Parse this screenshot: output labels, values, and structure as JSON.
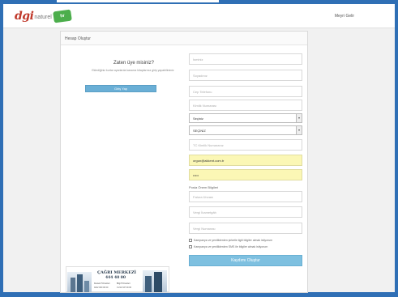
{
  "header": {
    "logo_main": "dgi",
    "logo_sub": "naturel",
    "logo_badge": "tv",
    "user_link": "Meyri Gelir"
  },
  "panel": {
    "title": "Hesap Oluştur"
  },
  "login": {
    "question": "Zaten üye misiniz?",
    "description": "Eklediğiniz kurtar ayarlarıla kasanız kitaplarınız giriş yapabilirsiniz",
    "button_label": "Giriş Yap"
  },
  "form": {
    "name_placeholder": "İsminiz",
    "surname_placeholder": "Soyadınız",
    "phone_placeholder": "Cep Telefonu",
    "tckn_placeholder": "Kimlik Numarası",
    "city_value": "Seçiniz",
    "district_value": "SEÇİNİZ",
    "birthdate_placeholder": "TC Kimlik Numaranız",
    "email_value": "orgun@akkent.com.tr",
    "password_value": "•••••",
    "extra_section_label": "Posta Önem Bilgileri",
    "extra_1_placeholder": "Fatura Ünvanı",
    "extra_2_placeholder": "Vergi İkametgâh",
    "extra_3_placeholder": "Vergi Numarası",
    "check_1_label": "Kampanya ve yeniliklerden şirketle ilgili bilgiler almak istiyorum",
    "check_2_label": "Kampanya ve yeniliklerden SMS ile bilgiler almak istiyorum",
    "submit_label": "Kaydımı Oluştur"
  },
  "banner": {
    "title": "ÇAĞRI MERKEZİ",
    "phone": "444 40 00",
    "left_small": "Destek Hizmetleri",
    "left_small_num": "0212 000 00 00",
    "right_small": "Bilgi Hizmetleri",
    "right_small_num": "0 212 347 00 00"
  },
  "colors": {
    "frame": "#2f6fb5",
    "button": "#6aafd6",
    "filled_field": "#fbf7b5",
    "logo_red": "#c0392b",
    "logo_green": "#4cae4c"
  }
}
